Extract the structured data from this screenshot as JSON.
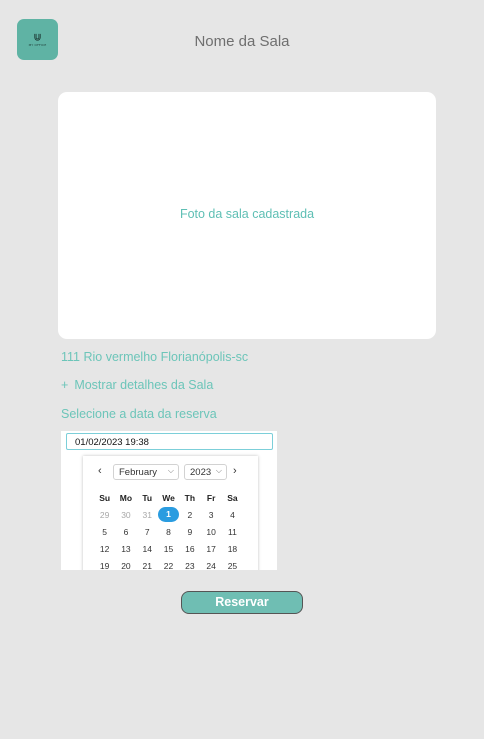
{
  "logo": {
    "text": "MY OFFICE"
  },
  "header": {
    "title": "Nome da Sala"
  },
  "photo": {
    "caption": "Foto da sala cadastrada"
  },
  "room": {
    "address": "111 Rio vermelho Florianópolis-sc",
    "details_plus": "+",
    "details_label": "Mostrar detalhes da Sala"
  },
  "reservation": {
    "date_label": "Selecione a data da reserva",
    "date_value": "01/02/2023 19:38"
  },
  "calendar": {
    "prev": "‹",
    "next": "›",
    "month": "February",
    "year": "2023",
    "weekdays": [
      "Su",
      "Mo",
      "Tu",
      "We",
      "Th",
      "Fr",
      "Sa"
    ],
    "weeks": [
      [
        "29",
        "30",
        "31",
        "1",
        "2",
        "3",
        "4"
      ],
      [
        "5",
        "6",
        "7",
        "8",
        "9",
        "10",
        "11"
      ],
      [
        "12",
        "13",
        "14",
        "15",
        "16",
        "17",
        "18"
      ],
      [
        "19",
        "20",
        "21",
        "22",
        "23",
        "24",
        "25"
      ]
    ],
    "selected_day": "1"
  },
  "actions": {
    "reserve_label": "Reservar"
  },
  "colors": {
    "accent": "#6fbeb3",
    "logo_bg": "#5fb3a4",
    "selected_day": "#2a9ce0"
  }
}
